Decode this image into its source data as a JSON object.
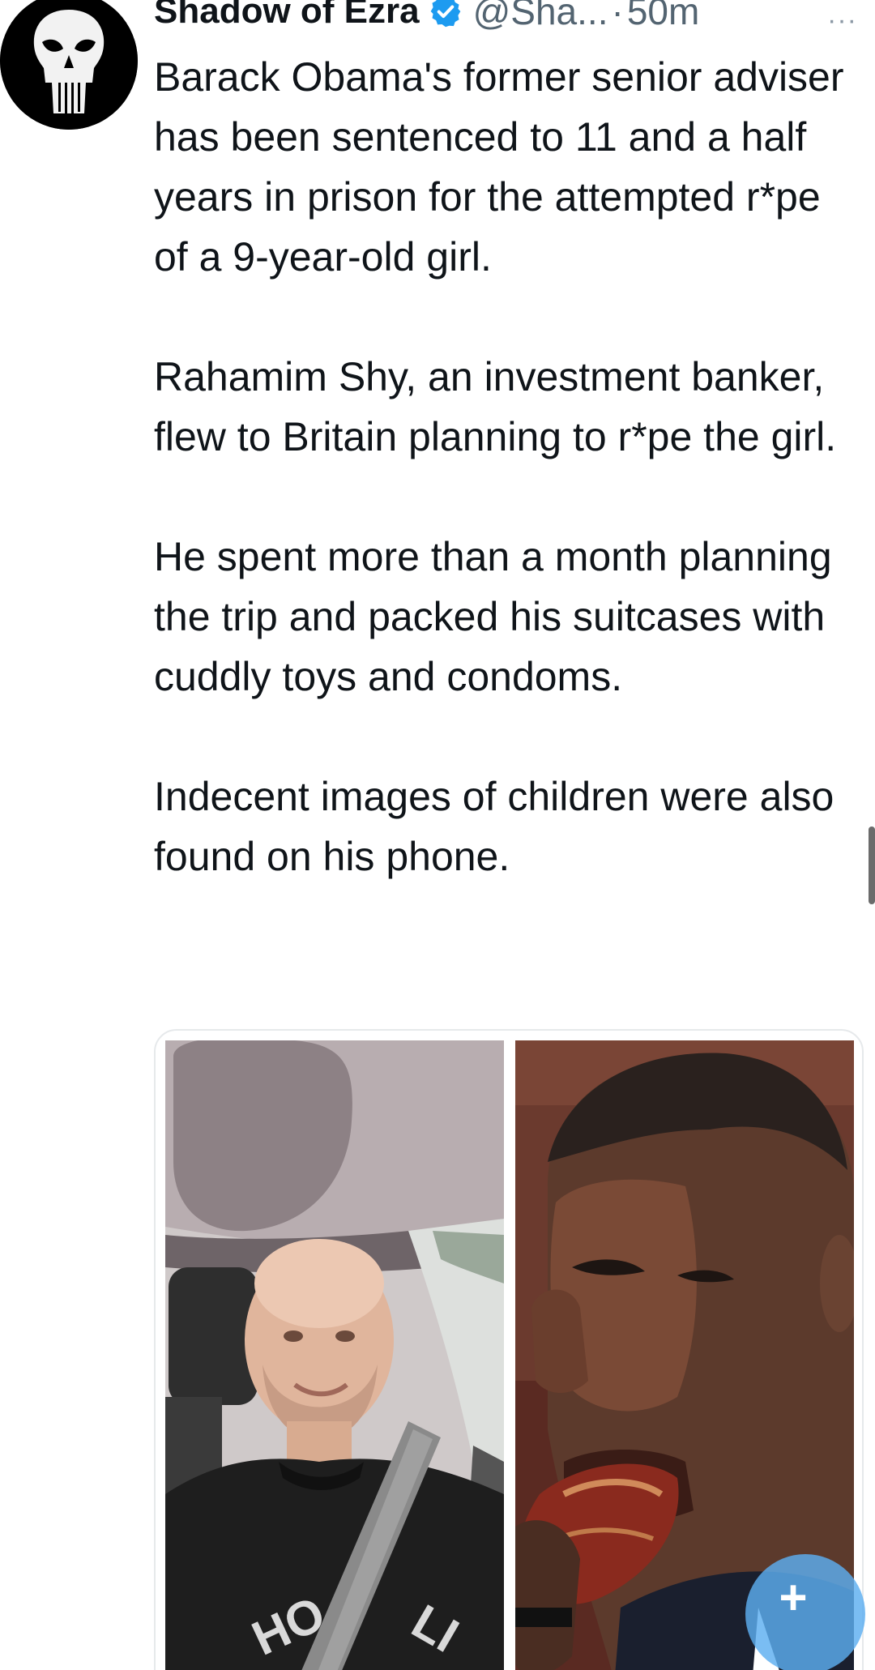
{
  "tweet": {
    "author": {
      "display_name": "Shadow of Ezra",
      "handle": "@Sha...",
      "separator": "·",
      "time": "50m",
      "verified": true
    },
    "more_glyph": "···",
    "paragraphs": [
      "Barack Obama's former senior adviser has been sentenced to 11 and a half years in prison for the attempted r*pe of a 9-year-old girl.",
      "Rahamim Shy, an investment banker, flew to Britain planning to r*pe the girl.",
      "He spent more than a month planning the trip and packed his suitcases with cuddly toys and condoms.",
      "Indecent images of children were also found on his phone."
    ]
  },
  "compose": {
    "glyph": "+"
  },
  "colors": {
    "text": "#0f1419",
    "secondary_text": "#536471",
    "verified_badge": "#1d9bf0",
    "compose_button": "#5dafF0",
    "media_border": "#e6e9eb"
  },
  "icons": {
    "avatar": "punisher-skull-icon",
    "verified": "verified-badge-icon",
    "more": "more-dots-icon",
    "compose": "plus-icon"
  }
}
